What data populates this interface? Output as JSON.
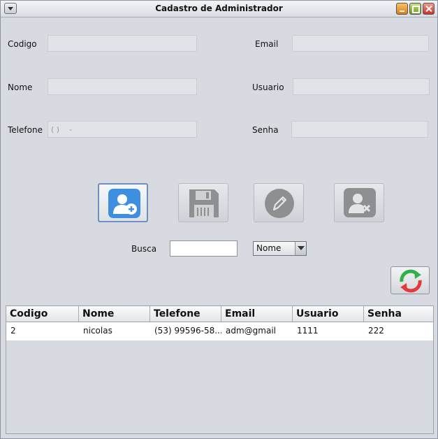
{
  "window": {
    "title": "Cadastro de Administrador"
  },
  "form": {
    "codigo_label": "Codigo",
    "nome_label": "Nome",
    "telefone_label": "Telefone",
    "telefone_mask": "( )    -",
    "email_label": "Email",
    "usuario_label": "Usuario",
    "senha_label": "Senha"
  },
  "actions": {
    "add_icon": "add-user-icon",
    "save_icon": "floppy-disk-icon",
    "edit_icon": "pencil-icon",
    "delete_icon": "remove-user-icon",
    "refresh_icon": "refresh-icon"
  },
  "search": {
    "label": "Busca",
    "value": "",
    "select_value": "Nome"
  },
  "table": {
    "columns": [
      "Codigo",
      "Nome",
      "Telefone",
      "Email",
      "Usuario",
      "Senha"
    ],
    "rows": [
      [
        "2",
        "nicolas",
        "(53) 99596-58...",
        "adm@gmail",
        "1111",
        "222"
      ]
    ]
  },
  "colors": {
    "accent": "#3f8fe0",
    "disabled_icon": "#8d8f93",
    "refresh_green": "#2fb14a",
    "refresh_red": "#e23a3a"
  }
}
